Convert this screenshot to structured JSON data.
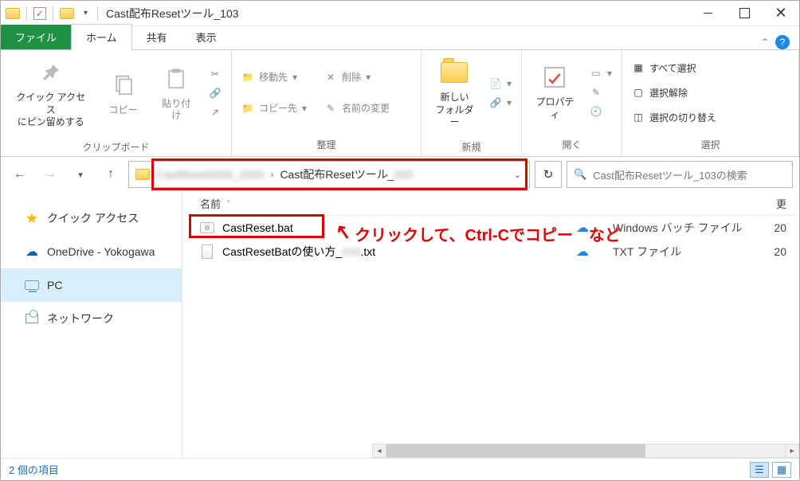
{
  "window": {
    "title": "Cast配布Resetツール_103"
  },
  "tabs": {
    "file": "ファイル",
    "home": "ホーム",
    "share": "共有",
    "view": "表示"
  },
  "ribbon": {
    "clipboard": {
      "label": "クリップボード",
      "pin": "クイック アクセス\nにピン留めする",
      "copy": "コピー",
      "paste": "貼り付け"
    },
    "organize": {
      "label": "整理",
      "moveto": "移動先",
      "copyto": "コピー先",
      "delete": "削除",
      "rename": "名前の変更"
    },
    "new": {
      "label": "新規",
      "newfolder": "新しい\nフォルダー"
    },
    "open": {
      "label": "開く",
      "properties": "プロパティ"
    },
    "select": {
      "label": "選択",
      "selectall": "すべて選択",
      "selectnone": "選択解除",
      "invert": "選択の切り替え"
    }
  },
  "address": {
    "crumb1_blur": "CastReset0000_2000",
    "crumb2": "Cast配布Resetツール_",
    "crumb2_blur": "000"
  },
  "search": {
    "placeholder": "Cast配布Resetツール_103の検索"
  },
  "annotation": {
    "text": "クリックして、Ctrl-Cでコピー　など"
  },
  "nav": {
    "quick": "クイック アクセス",
    "onedrive": "OneDrive - Yokogawa",
    "pc": "PC",
    "network": "ネットワーク"
  },
  "columns": {
    "name": "名前",
    "type_hdr": "",
    "date_hdr": "更"
  },
  "files": [
    {
      "name": "CastReset.bat",
      "type": "Windows バッチ ファイル",
      "date": "20"
    },
    {
      "name_pre": "CastResetBatの使い方_",
      "name_blur": "000",
      "name_post": ".txt",
      "type": "TXT ファイル",
      "date": "20"
    }
  ],
  "status": {
    "text": "2 個の項目"
  }
}
